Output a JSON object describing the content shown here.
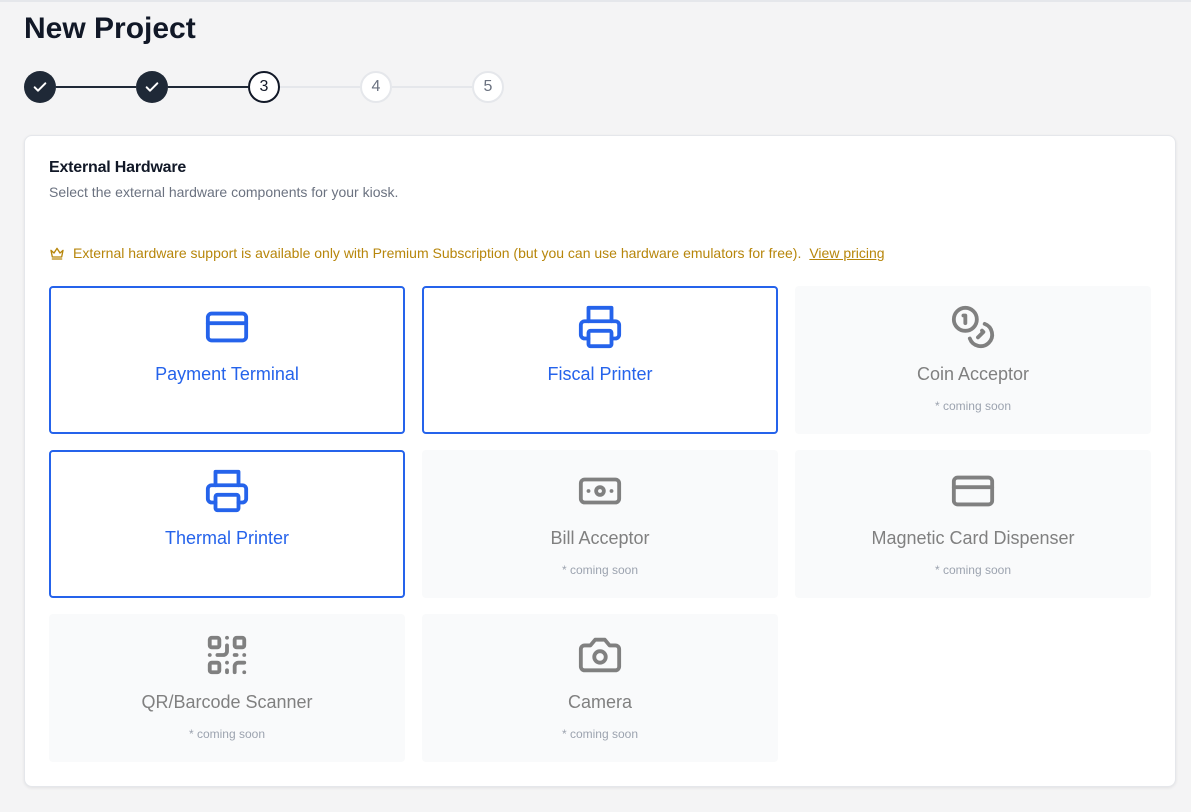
{
  "page": {
    "title": "New Project"
  },
  "stepper": {
    "current": 3,
    "steps": [
      {
        "label": "",
        "state": "done"
      },
      {
        "label": "",
        "state": "done"
      },
      {
        "label": "3",
        "state": "current"
      },
      {
        "label": "4",
        "state": "todo"
      },
      {
        "label": "5",
        "state": "todo"
      }
    ]
  },
  "section": {
    "title": "External Hardware",
    "subtitle": "Select the external hardware components for your kiosk."
  },
  "notice": {
    "icon": "crown-icon",
    "text": "External hardware support is available only with Premium Subscription (but you can use hardware emulators for free).",
    "link": "View pricing"
  },
  "tiles": [
    {
      "label": "Payment Terminal",
      "icon": "credit-card-icon",
      "selected": true,
      "note": ""
    },
    {
      "label": "Fiscal Printer",
      "icon": "printer-icon",
      "selected": true,
      "note": ""
    },
    {
      "label": "Coin Acceptor",
      "icon": "coins-icon",
      "selected": false,
      "note": "* coming soon"
    },
    {
      "label": "Thermal Printer",
      "icon": "printer-icon",
      "selected": true,
      "note": ""
    },
    {
      "label": "Bill Acceptor",
      "icon": "banknote-icon",
      "selected": false,
      "note": "* coming soon"
    },
    {
      "label": "Magnetic Card Dispenser",
      "icon": "credit-card-icon",
      "selected": false,
      "note": "* coming soon"
    },
    {
      "label": "QR/Barcode Scanner",
      "icon": "qr-code-icon",
      "selected": false,
      "note": "* coming soon"
    },
    {
      "label": "Camera",
      "icon": "camera-icon",
      "selected": false,
      "note": "* coming soon"
    }
  ],
  "colors": {
    "accent": "#2563eb",
    "warning": "#b7860b",
    "done_step": "#1f2937",
    "muted": "#808080"
  }
}
